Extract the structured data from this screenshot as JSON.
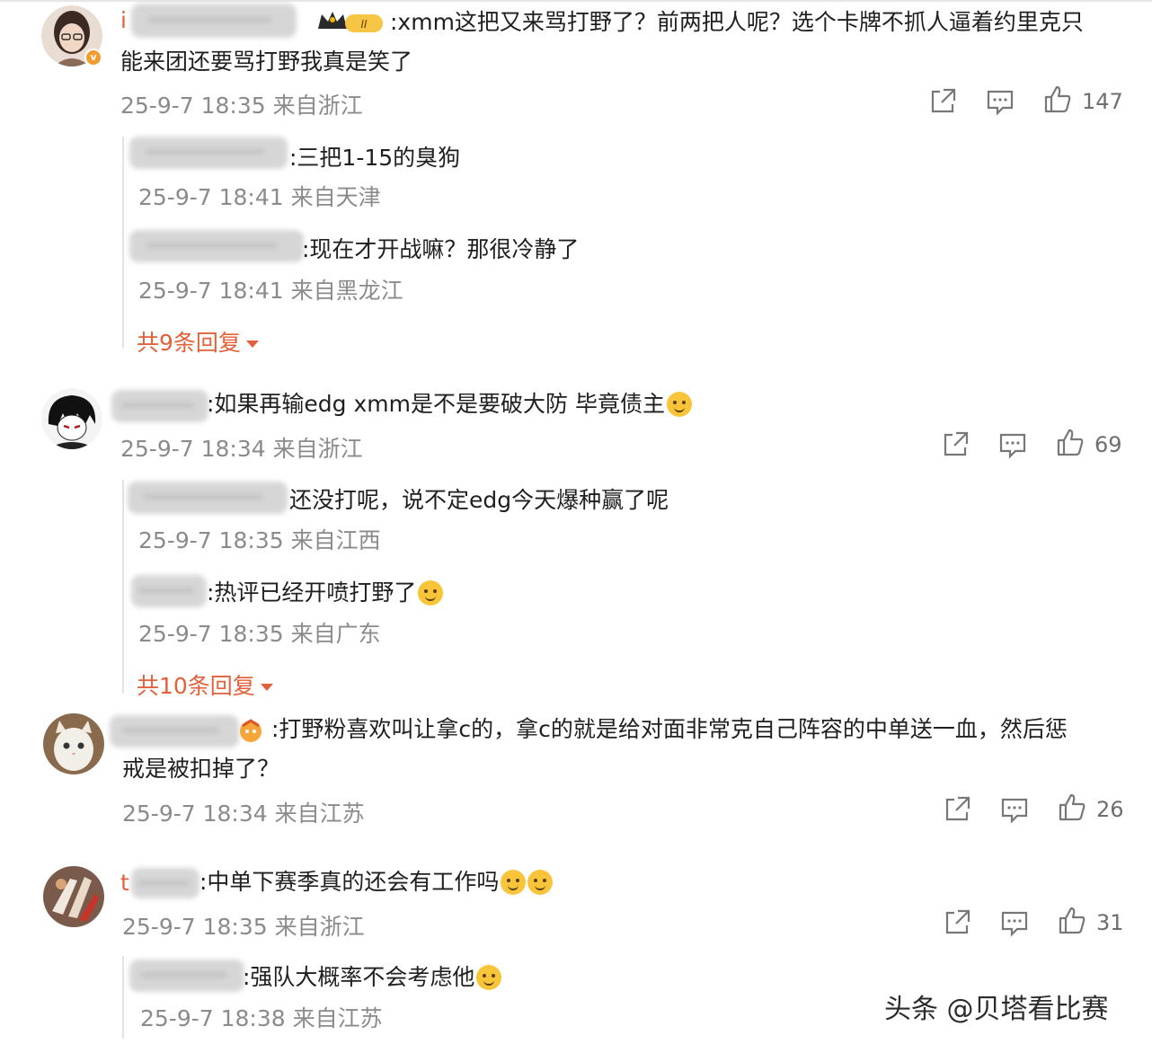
{
  "watermark": "头条 @贝塔看比赛",
  "comments": [
    {
      "user_fragment": "i",
      "text_line1": ":xmm这把又来骂打野了？前两把人呢？选个卡牌不抓人逼着约里克只",
      "text_line2": "能来团还要骂打野我真是笑了",
      "meta": "25-9-7 18:35 来自浙江",
      "likes": "147",
      "replies": [
        {
          "text": ":三把1-15的臭狗",
          "meta": "25-9-7 18:41 来自天津"
        },
        {
          "text": ":现在才开战嘛？那很冷静了",
          "meta": "25-9-7 18:41 来自黑龙江"
        }
      ],
      "more_replies": "共9条回复"
    },
    {
      "text_line1": ":如果再输edg xmm是不是要破大防 毕竟债主",
      "meta": "25-9-7 18:34 来自浙江",
      "likes": "69",
      "replies": [
        {
          "text": "还没打呢，说不定edg今天爆种赢了呢",
          "meta": "25-9-7 18:35 来自江西"
        },
        {
          "text": ":热评已经开喷打野了",
          "meta": "25-9-7 18:35 来自广东"
        }
      ],
      "more_replies": "共10条回复"
    },
    {
      "text_line1": ":打野粉喜欢叫让拿c的，拿c的就是给对面非常克自己阵容的中单送一血，然后惩",
      "text_line2": "戒是被扣掉了？",
      "meta": "25-9-7 18:34 来自江苏",
      "likes": "26"
    },
    {
      "user_fragment": "t",
      "text_line1": ":中单下赛季真的还会有工作吗",
      "meta": "25-9-7 18:35 来自浙江",
      "likes": "31",
      "replies": [
        {
          "text": ":强队大概率不会考虑他",
          "meta": "25-9-7 18:38 来自江苏"
        }
      ]
    }
  ],
  "icons": {
    "share": "share-icon",
    "comment": "comment-icon",
    "like": "thumbs-up-icon"
  },
  "colors": {
    "meta": "#8b8b8b",
    "more_replies": "#e2603a",
    "text": "#1f1f1f"
  }
}
